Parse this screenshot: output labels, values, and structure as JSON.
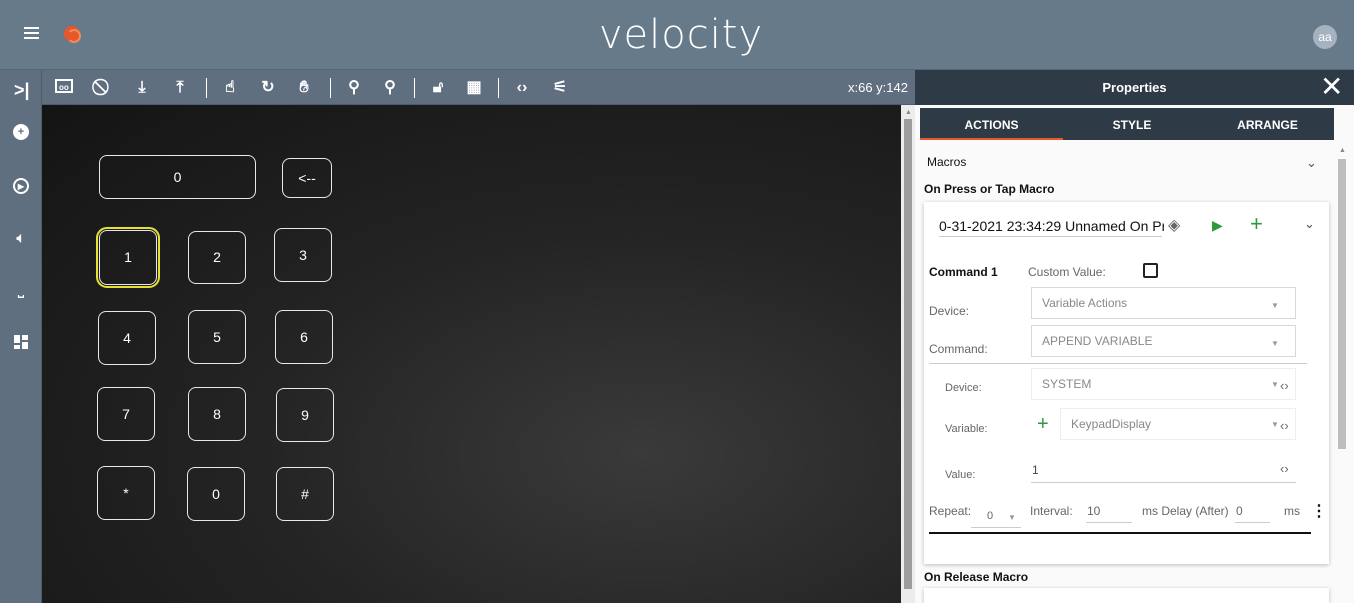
{
  "header": {
    "brand": "velocity",
    "avatar_initials": "aa"
  },
  "toolbar": {
    "coordinates": "x:66 y:142"
  },
  "keypad": {
    "display": "0",
    "backspace": "<--",
    "keys": [
      "1",
      "2",
      "3",
      "4",
      "5",
      "6",
      "7",
      "8",
      "9",
      "*",
      "0",
      "#"
    ]
  },
  "properties": {
    "title": "Properties",
    "tabs": [
      "ACTIONS",
      "STYLE",
      "ARRANGE"
    ],
    "macros_label": "Macros",
    "on_press_label": "On Press or Tap Macro",
    "macro_name": "0-31-2021 23:34:29 Unnamed On Pr",
    "command_label": "Command 1",
    "custom_value_label": "Custom Value:",
    "device_label": "Device:",
    "device_value": "Variable Actions",
    "command_field_label": "Command:",
    "command_value": "APPEND VARIABLE",
    "sub_device_label": "Device:",
    "sub_device_value": "SYSTEM",
    "variable_label": "Variable:",
    "variable_value": "KeypadDisplay",
    "value_label": "Value:",
    "value_value": "1",
    "repeat_label": "Repeat:",
    "repeat_value": "0",
    "interval_label": "Interval:",
    "interval_value": "10",
    "ms_delay_label": "ms Delay (After)",
    "delay_value": "0",
    "ms_label": "ms",
    "on_release_label": "On Release Macro"
  },
  "colors": {
    "accent": "#e8572a",
    "selection": "#e6df35",
    "header": "#667a89",
    "panel_dark": "#2e3a46",
    "green": "#2e9a3c"
  }
}
